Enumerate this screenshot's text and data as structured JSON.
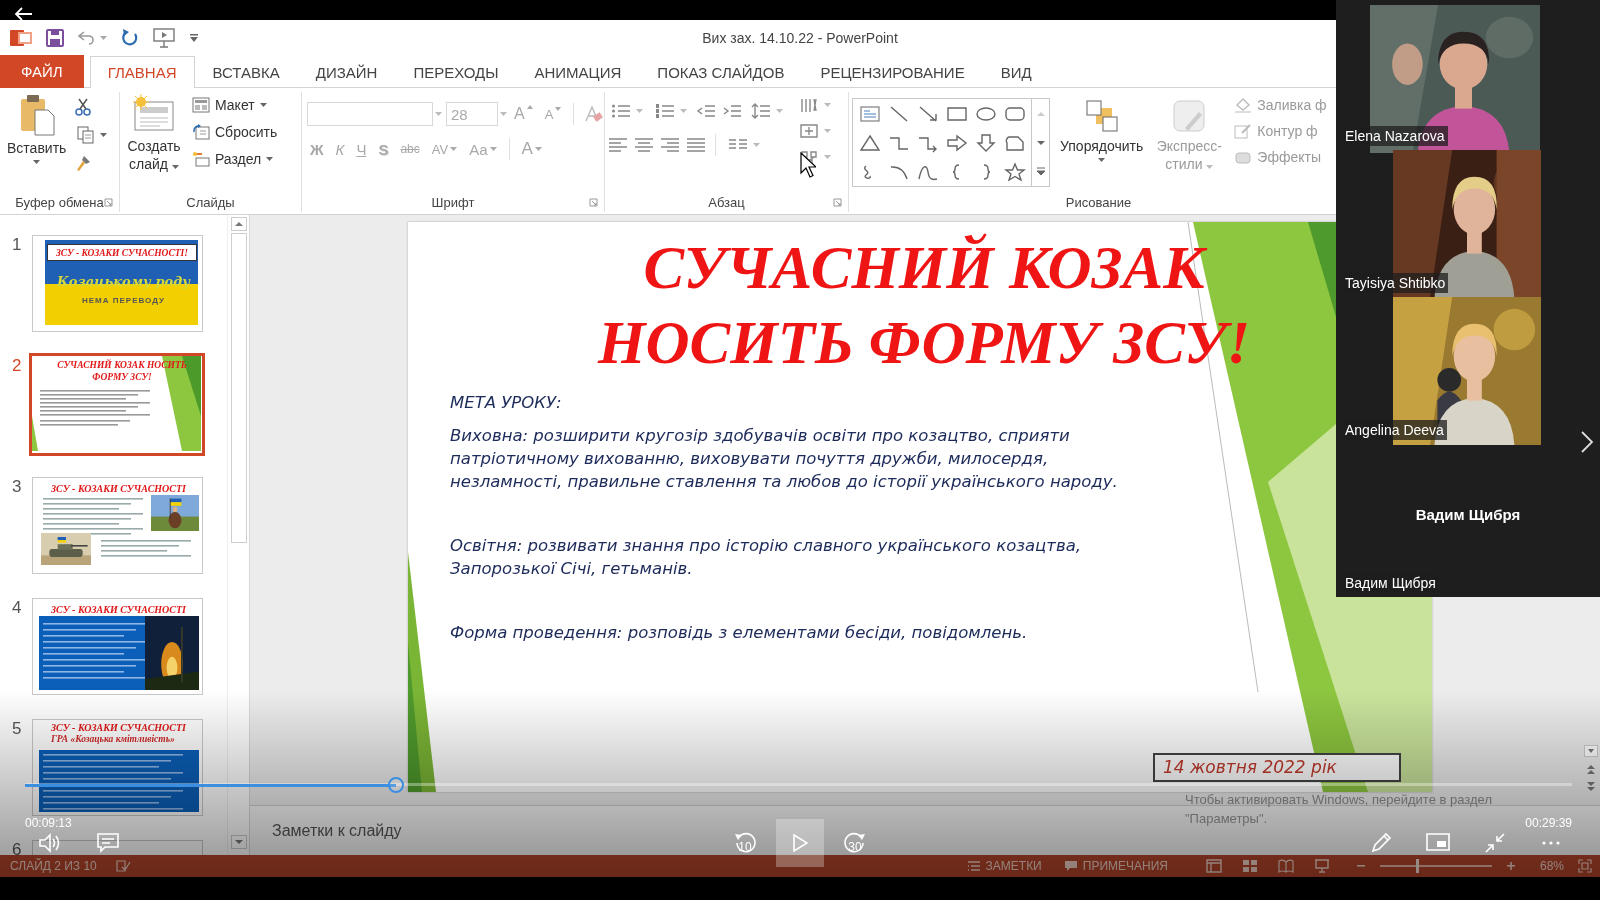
{
  "window": {
    "title": "Вих зах. 14.10.22 - PowerPoint"
  },
  "tabs": [
    {
      "label": "ФАЙЛ",
      "kind": "file",
      "selected": false
    },
    {
      "label": "ГЛАВНАЯ",
      "kind": "tab",
      "selected": true
    },
    {
      "label": "ВСТАВКА",
      "kind": "tab",
      "selected": false
    },
    {
      "label": "ДИЗАЙН",
      "kind": "tab",
      "selected": false
    },
    {
      "label": "ПЕРЕХОДЫ",
      "kind": "tab",
      "selected": false
    },
    {
      "label": "АНИМАЦИЯ",
      "kind": "tab",
      "selected": false
    },
    {
      "label": "ПОКАЗ СЛАЙДОВ",
      "kind": "tab",
      "selected": false
    },
    {
      "label": "РЕЦЕНЗИРОВАНИЕ",
      "kind": "tab",
      "selected": false
    },
    {
      "label": "ВИД",
      "kind": "tab",
      "selected": false
    }
  ],
  "ribbon": [
    {
      "kind": "clipboard",
      "label": "Буфер обмена",
      "items": [
        {
          "label": "Вставить",
          "disabled": false
        }
      ]
    },
    {
      "kind": "slides",
      "label": "Слайды",
      "items": [
        {
          "label": "Создать слайд",
          "disabled": false
        },
        {
          "label": "Макет",
          "disabled": false
        },
        {
          "label": "Сбросить",
          "disabled": false
        },
        {
          "label": "Раздел",
          "disabled": false
        }
      ]
    },
    {
      "kind": "font",
      "label": "Шрифт",
      "disabled": true,
      "font_size": "28",
      "size_buttons": [
        "A",
        "A"
      ],
      "format_buttons": [
        "Ж",
        "К",
        "Ч",
        "S",
        "abc",
        "AV",
        "Aa",
        "A"
      ]
    },
    {
      "kind": "paragraph",
      "label": "Абзац"
    },
    {
      "kind": "drawing",
      "label": "Рисование",
      "items": [
        {
          "label": "Упорядочить",
          "disabled": false
        },
        {
          "label": "Экспресс-стили",
          "disabled": true
        },
        {
          "label": "Заливка ф",
          "disabled": true
        },
        {
          "label": "Контур ф",
          "disabled": true
        },
        {
          "label": "Эффекты",
          "disabled": true
        }
      ]
    }
  ],
  "thumbnails": [
    {
      "number": "1",
      "selected": false,
      "kind": "flag",
      "title": "ЗСУ - КОЗАКИ СУЧАСНОСТІ!",
      "subtitle": "Козацькому роду",
      "caption": "НЕМА ПЕРЕВОДУ"
    },
    {
      "number": "2",
      "selected": true,
      "kind": "text",
      "title": "СУЧАСНИЙ КОЗАК НОСИТЬ ФОРМУ ЗСУ!"
    },
    {
      "number": "3",
      "selected": false,
      "title": "ЗСУ - КОЗАКИ СУЧАСНОСТІ"
    },
    {
      "number": "4",
      "selected": false,
      "kind": "blue-photo",
      "title": "ЗСУ - КОЗАКИ СУЧАСНОСТІ"
    },
    {
      "number": "5",
      "selected": false,
      "kind": "blue",
      "title": "ЗСУ - КОЗАКИ СУЧАСНОСТІ",
      "subtitle": "ГРА «Козацька кмітливість»"
    },
    {
      "number": "6",
      "selected": false,
      "kind": "hidden"
    }
  ],
  "slide": {
    "title_lines": [
      "СУЧАСНИЙ КОЗАК",
      "НОСИТЬ ФОРМУ ЗСУ!"
    ],
    "heading": "МЕТА УРОКУ:",
    "paragraphs": [
      {
        "lines": [
          "Виховна: розширити кругозір здобувачів освіти про козацтво, сприяти",
          "патріотичному вихованню, виховувати почуття дружби, милосердя,",
          "незламності, правильне ставлення та любов до історії українського народу."
        ]
      },
      {
        "lines": [
          "Освітня: розвивати знання про історію славного українського козацтва,",
          "Запорозької Січі, гетьманів."
        ]
      },
      {
        "lines": [
          "Форма проведення: розповідь з елементами бесіди, повідомлень."
        ]
      }
    ],
    "date": "14 жовтня 2022 рік"
  },
  "notes": {
    "placeholder": "Заметки к слайду"
  },
  "activation_notice": [
    "Чтобы активировать Windows, перейдите в раздел",
    "\"Параметры\"."
  ],
  "status_bar": {
    "slide": "СЛАЙД 2 ИЗ 10",
    "notes": "ЗАМЕТКИ",
    "comments": "ПРИМЕЧАНИЯ",
    "zoom": "68%",
    "level": 0.33
  },
  "call": {
    "participants": [
      {
        "kind": "video",
        "name": "Elena Nazarova"
      },
      {
        "kind": "video",
        "name": "Tayisiya Shtibko"
      },
      {
        "kind": "video",
        "name": "Angelina Deeva"
      },
      {
        "kind": "audio",
        "center_name": "Вадим Щибря",
        "name": "Вадим Щибря"
      }
    ]
  },
  "player": {
    "elapsed": "00:09:13",
    "duration": "00:29:39",
    "level": 0.24,
    "rewind": "10",
    "forward": "30"
  }
}
